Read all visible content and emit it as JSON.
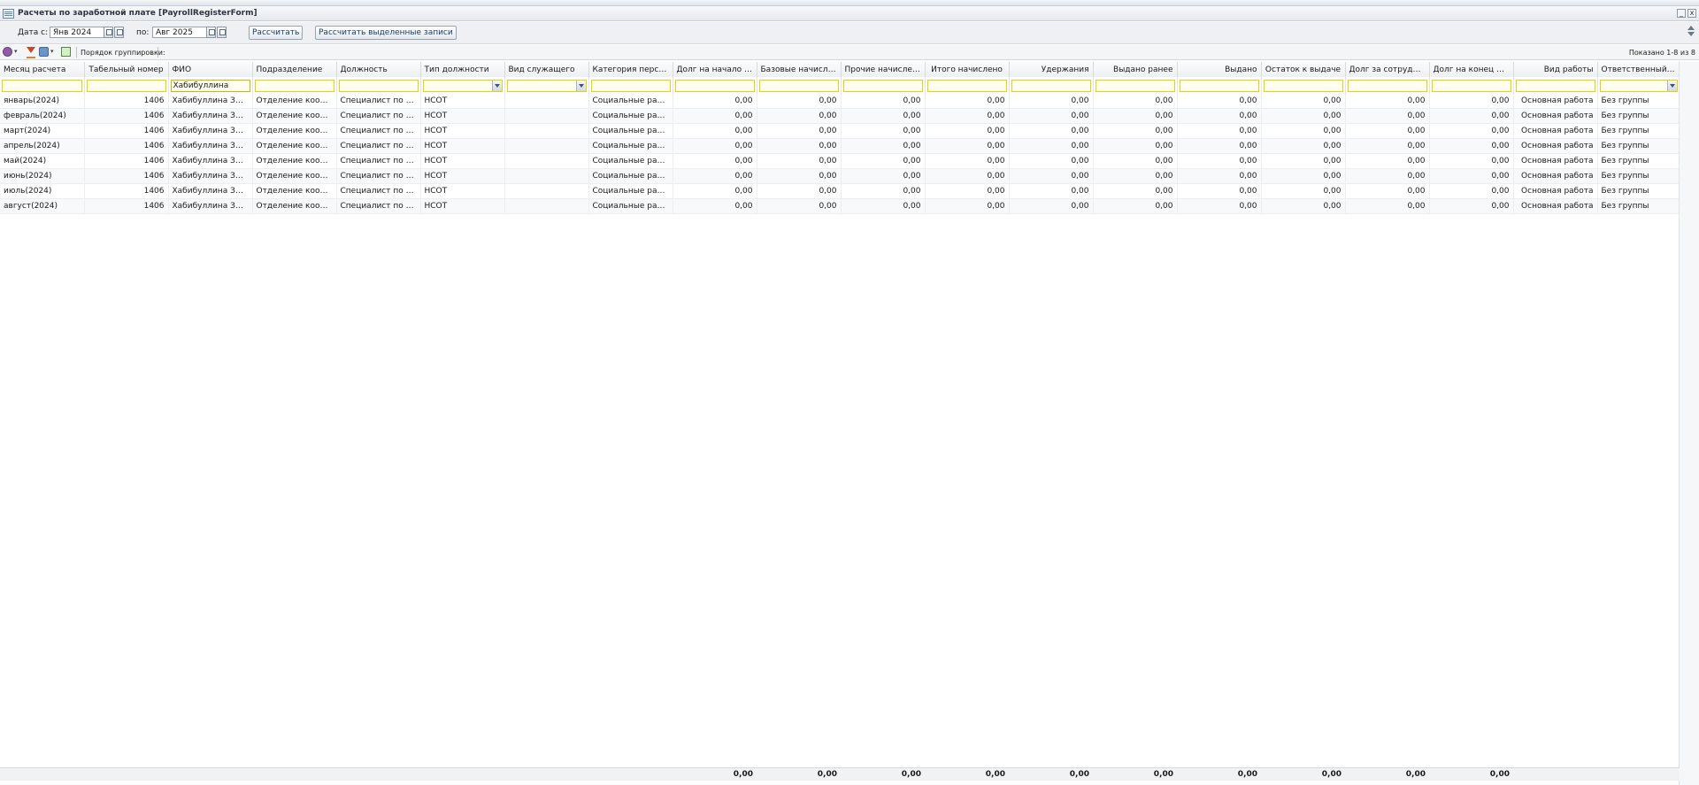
{
  "window": {
    "title": "Расчеты по заработной плате [PayrollRegisterForm]",
    "buttons": [
      "_",
      "x"
    ]
  },
  "params": {
    "date_from_label": "Дата с:",
    "date_from": "Янв 2024",
    "date_to_label": "по:",
    "date_to": "Авг 2025",
    "calc_button": "Рассчитать",
    "calc_selected_button": "Рассчитать выделенные записи"
  },
  "toolbar": {
    "grouping_label": "Порядок группировки:",
    "shown_text": "Показано 1-8 из 8"
  },
  "columns": [
    "Месяц расчета",
    "Табельный номер",
    "ФИО",
    "Подразделение",
    "Должность",
    "Тип должности",
    "Вид служащего",
    "Категория персом...",
    "Долг на начало м...",
    "Базовые начислен...",
    "Прочие начисления",
    "Итого начислено",
    "Удержания",
    "Выдано ранее",
    "Выдано",
    "Остаток к выдаче",
    "Долг за сотрудник...",
    "Долг на конец ме...",
    "Вид работы",
    "Ответственный расч..."
  ],
  "filters": {
    "fio": "Хабибуллина"
  },
  "rows": [
    [
      "январь(2024)",
      "1406",
      "Хабибуллина Зиля Н...",
      "Отделение координа...",
      "Специалист по соци...",
      "НСОТ",
      "",
      "Социальные работни...",
      "0,00",
      "0,00",
      "0,00",
      "0,00",
      "0,00",
      "0,00",
      "0,00",
      "0,00",
      "0,00",
      "0,00",
      "Основная работа",
      "Без группы"
    ],
    [
      "февраль(2024)",
      "1406",
      "Хабибуллина Зиля Н...",
      "Отделение координа...",
      "Специалист по соци...",
      "НСОТ",
      "",
      "Социальные работни...",
      "0,00",
      "0,00",
      "0,00",
      "0,00",
      "0,00",
      "0,00",
      "0,00",
      "0,00",
      "0,00",
      "0,00",
      "Основная работа",
      "Без группы"
    ],
    [
      "март(2024)",
      "1406",
      "Хабибуллина Зиля Н...",
      "Отделение координа...",
      "Специалист по соци...",
      "НСОТ",
      "",
      "Социальные работни...",
      "0,00",
      "0,00",
      "0,00",
      "0,00",
      "0,00",
      "0,00",
      "0,00",
      "0,00",
      "0,00",
      "0,00",
      "Основная работа",
      "Без группы"
    ],
    [
      "апрель(2024)",
      "1406",
      "Хабибуллина Зиля Н...",
      "Отделение координа...",
      "Специалист по соци...",
      "НСОТ",
      "",
      "Социальные работни...",
      "0,00",
      "0,00",
      "0,00",
      "0,00",
      "0,00",
      "0,00",
      "0,00",
      "0,00",
      "0,00",
      "0,00",
      "Основная работа",
      "Без группы"
    ],
    [
      "май(2024)",
      "1406",
      "Хабибуллина Зиля Н...",
      "Отделение координа...",
      "Специалист по соци...",
      "НСОТ",
      "",
      "Социальные работни...",
      "0,00",
      "0,00",
      "0,00",
      "0,00",
      "0,00",
      "0,00",
      "0,00",
      "0,00",
      "0,00",
      "0,00",
      "Основная работа",
      "Без группы"
    ],
    [
      "июнь(2024)",
      "1406",
      "Хабибуллина Зиля Н...",
      "Отделение координа...",
      "Специалист по соци...",
      "НСОТ",
      "",
      "Социальные работни...",
      "0,00",
      "0,00",
      "0,00",
      "0,00",
      "0,00",
      "0,00",
      "0,00",
      "0,00",
      "0,00",
      "0,00",
      "Основная работа",
      "Без группы"
    ],
    [
      "июль(2024)",
      "1406",
      "Хабибуллина Зиля Н...",
      "Отделение координа...",
      "Специалист по соци...",
      "НСОТ",
      "",
      "Социальные работни...",
      "0,00",
      "0,00",
      "0,00",
      "0,00",
      "0,00",
      "0,00",
      "0,00",
      "0,00",
      "0,00",
      "0,00",
      "Основная работа",
      "Без группы"
    ],
    [
      "август(2024)",
      "1406",
      "Хабибуллина Зиля Н...",
      "Отделение координа...",
      "Специалист по соци...",
      "НСОТ",
      "",
      "Социальные работни...",
      "0,00",
      "0,00",
      "0,00",
      "0,00",
      "0,00",
      "0,00",
      "0,00",
      "0,00",
      "0,00",
      "0,00",
      "Основная работа",
      "Без группы"
    ]
  ],
  "totals": [
    "0,00",
    "0,00",
    "0,00",
    "0,00",
    "0,00",
    "0,00",
    "0,00",
    "0,00",
    "0,00",
    "0,00"
  ]
}
